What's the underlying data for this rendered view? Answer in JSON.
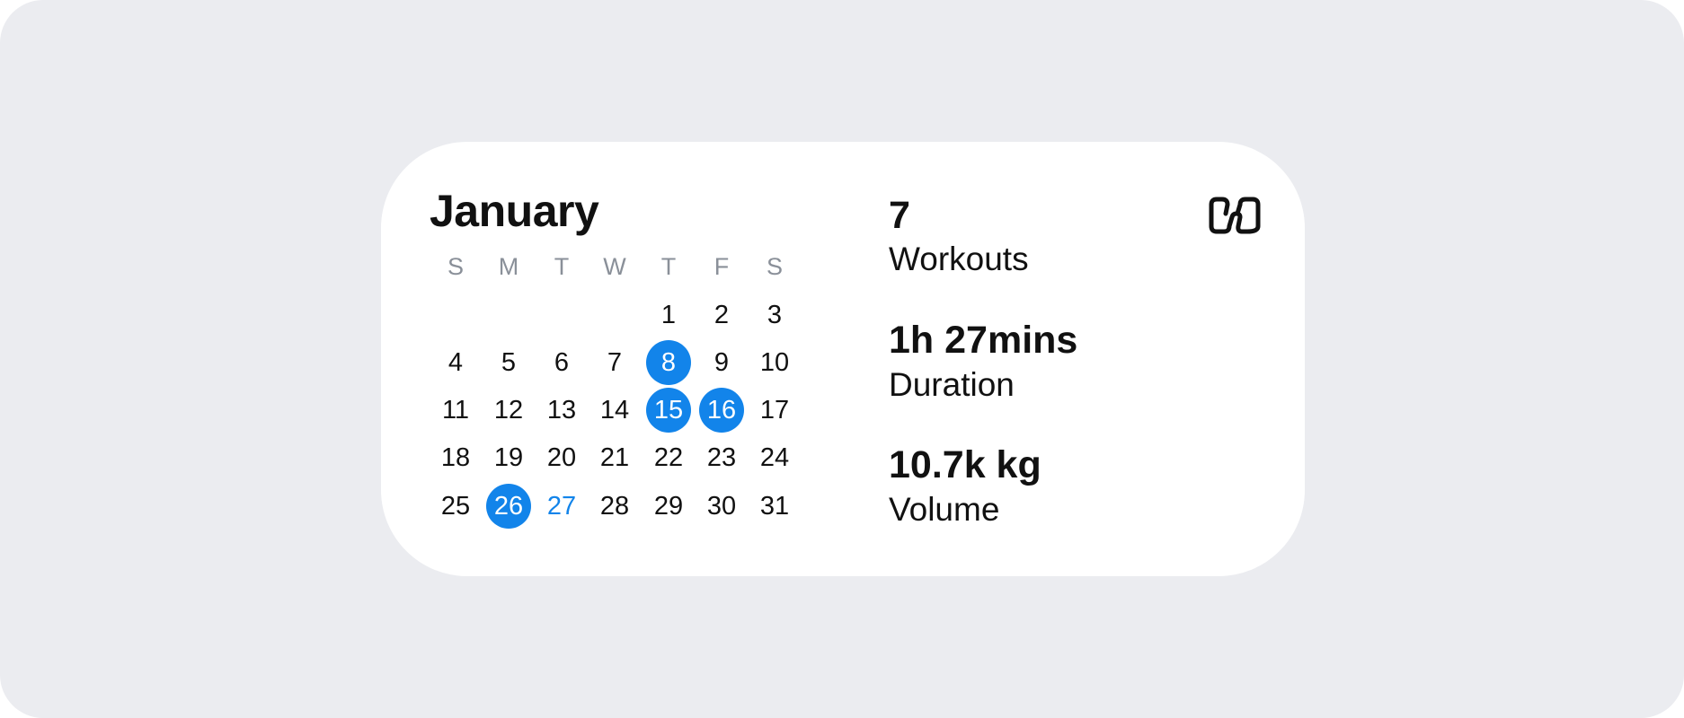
{
  "calendar": {
    "month": "January",
    "weekdays": [
      "S",
      "M",
      "T",
      "W",
      "T",
      "F",
      "S"
    ],
    "days": [
      "1",
      "2",
      "3",
      "4",
      "5",
      "6",
      "7",
      "8",
      "9",
      "10",
      "11",
      "12",
      "13",
      "14",
      "15",
      "16",
      "17",
      "18",
      "19",
      "20",
      "21",
      "22",
      "23",
      "24",
      "25",
      "26",
      "27",
      "28",
      "29",
      "30",
      "31"
    ],
    "workout_days": [
      8,
      15,
      16,
      26
    ],
    "today": 27
  },
  "stats": [
    {
      "value": "7",
      "label": "Workouts"
    },
    {
      "value": "1h 27mins",
      "label": "Duration"
    },
    {
      "value": "10.7k kg",
      "label": "Volume"
    }
  ],
  "logo_icon": "hevy-logo-icon",
  "colors": {
    "accent": "#1284EA",
    "background": "#EBECF0",
    "card": "#FFFFFF",
    "text": "#111111",
    "weekday_text": "#8A9099"
  }
}
